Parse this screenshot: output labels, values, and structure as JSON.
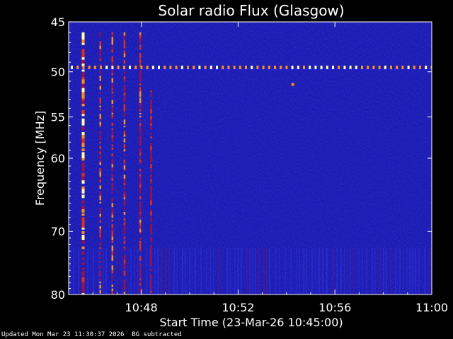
{
  "chart_data": {
    "type": "heatmap",
    "title": "Solar radio Flux (Glasgow)",
    "ylabel": "Frequency [MHz]",
    "xlabel": "Start Time (23-Mar-26 10:45:00)",
    "ylim": [
      45,
      80
    ],
    "y_scale": "log",
    "yticks": [
      "45",
      "50",
      "55",
      "60",
      "70",
      "80"
    ],
    "y_tick_values": [
      45,
      50,
      55,
      60,
      70,
      80
    ],
    "xticks": [
      "10:48",
      "10:52",
      "10:56",
      "11:00"
    ],
    "x_tick_minutes": [
      3,
      7,
      11,
      15
    ],
    "xlim_minutes": [
      0,
      15
    ],
    "colormap": [
      "#000030",
      "#1010a0",
      "#2020d8",
      "#a01040",
      "#e03010",
      "#ff9010",
      "#ffffa0"
    ],
    "background_color": "#1a1ab8",
    "interference_band_mhz": 49.5,
    "burst_times_minutes": [
      0.6,
      1.3,
      1.8,
      2.3,
      2.95,
      3.4
    ]
  },
  "footer": {
    "updated": "Updated Mon Mar 23 11:30:37 2026",
    "mode": "BG subtracted"
  }
}
